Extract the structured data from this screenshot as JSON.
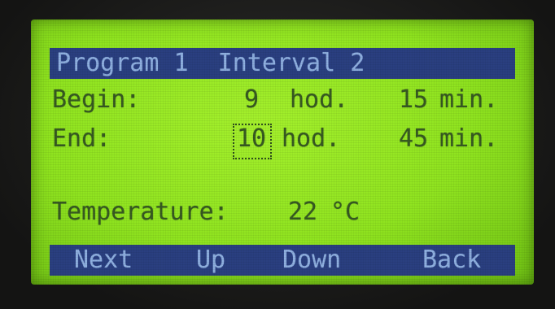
{
  "screen": {
    "title": "Program 1  Interval 2",
    "begin": {
      "label": "Begin:",
      "hours": "9",
      "hours_unit": "hod.",
      "minutes": "15",
      "minutes_unit": "min."
    },
    "end": {
      "label": "End:",
      "hours": "10",
      "hours_unit": "hod.",
      "minutes": "45",
      "minutes_unit": "min."
    },
    "temperature": {
      "label": "Temperature:",
      "value": "22",
      "unit": "°C"
    }
  },
  "softkeys": {
    "next": "Next",
    "up": "Up",
    "down": "Down",
    "back": "Back"
  },
  "colors": {
    "lcd_background": "#9be82a",
    "lcd_text": "#375a22",
    "bar_background": "#2a3f80",
    "bar_text": "#8fb0e0"
  }
}
